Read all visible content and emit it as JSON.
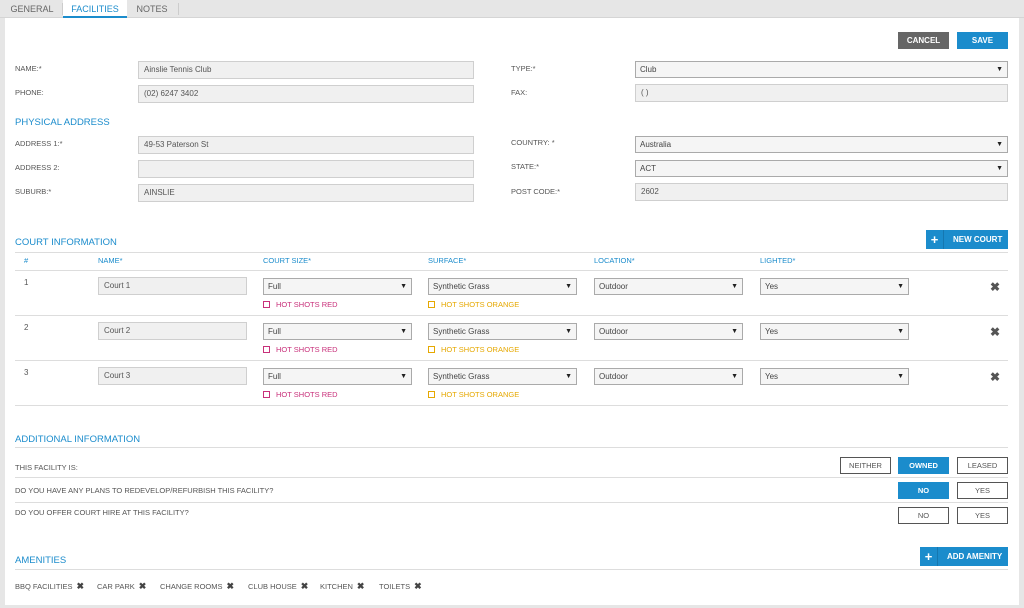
{
  "tabs": [
    "GENERAL",
    "FACILITIES",
    "NOTES"
  ],
  "actions": {
    "cancel": "CANCEL",
    "save": "SAVE"
  },
  "form": {
    "name_label": "NAME:*",
    "name_value": "Ainslie Tennis Club",
    "phone_label": "PHONE:",
    "phone_value": "(02) 6247 3402",
    "type_label": "TYPE:*",
    "type_value": "Club",
    "fax_label": "FAX:",
    "fax_value": "(   )"
  },
  "physical_address": {
    "title": "PHYSICAL ADDRESS",
    "address1_label": "ADDRESS 1:*",
    "address1_value": "49-53 Paterson St",
    "address2_label": "ADDRESS 2:",
    "address2_value": "",
    "suburb_label": "SUBURB:*",
    "suburb_value": "AINSLIE",
    "country_label": "COUNTRY: *",
    "country_value": "Australia",
    "state_label": "STATE:*",
    "state_value": "ACT",
    "postcode_label": "POST CODE:*",
    "postcode_value": "2602"
  },
  "court_info": {
    "title": "COURT INFORMATION",
    "new_court": "NEW COURT",
    "headers": {
      "num": "#",
      "name": "NAME*",
      "size": "COURT SIZE*",
      "surface": "SURFACE*",
      "location": "LOCATION*",
      "lighted": "LIGHTED*"
    },
    "hot_red": "HOT SHOTS RED",
    "hot_orange": "HOT SHOTS ORANGE",
    "courts": [
      {
        "num": "1",
        "name": "Court 1",
        "size": "Full",
        "surface": "Synthetic Grass",
        "location": "Outdoor",
        "lighted": "Yes"
      },
      {
        "num": "2",
        "name": "Court 2",
        "size": "Full",
        "surface": "Synthetic Grass",
        "location": "Outdoor",
        "lighted": "Yes"
      },
      {
        "num": "3",
        "name": "Court 3",
        "size": "Full",
        "surface": "Synthetic Grass",
        "location": "Outdoor",
        "lighted": "Yes"
      }
    ]
  },
  "additional": {
    "title": "ADDITIONAL INFORMATION",
    "q1": "THIS FACILITY IS:",
    "q1_options": [
      "NEITHER",
      "OWNED",
      "LEASED"
    ],
    "q1_selected": "OWNED",
    "q2": "DO YOU HAVE ANY PLANS TO REDEVELOP/REFURBISH THIS FACILITY?",
    "q2_options": [
      "NO",
      "YES"
    ],
    "q2_selected": "NO",
    "q3": "DO YOU OFFER COURT HIRE AT THIS FACILITY?",
    "q3_options": [
      "NO",
      "YES"
    ],
    "q3_selected": ""
  },
  "amenities": {
    "title": "AMENITIES",
    "add": "ADD AMENITY",
    "items": [
      "BBQ FACILITIES",
      "CAR PARK",
      "CHANGE ROOMS",
      "CLUB HOUSE",
      "KITCHEN",
      "TOILETS"
    ]
  }
}
